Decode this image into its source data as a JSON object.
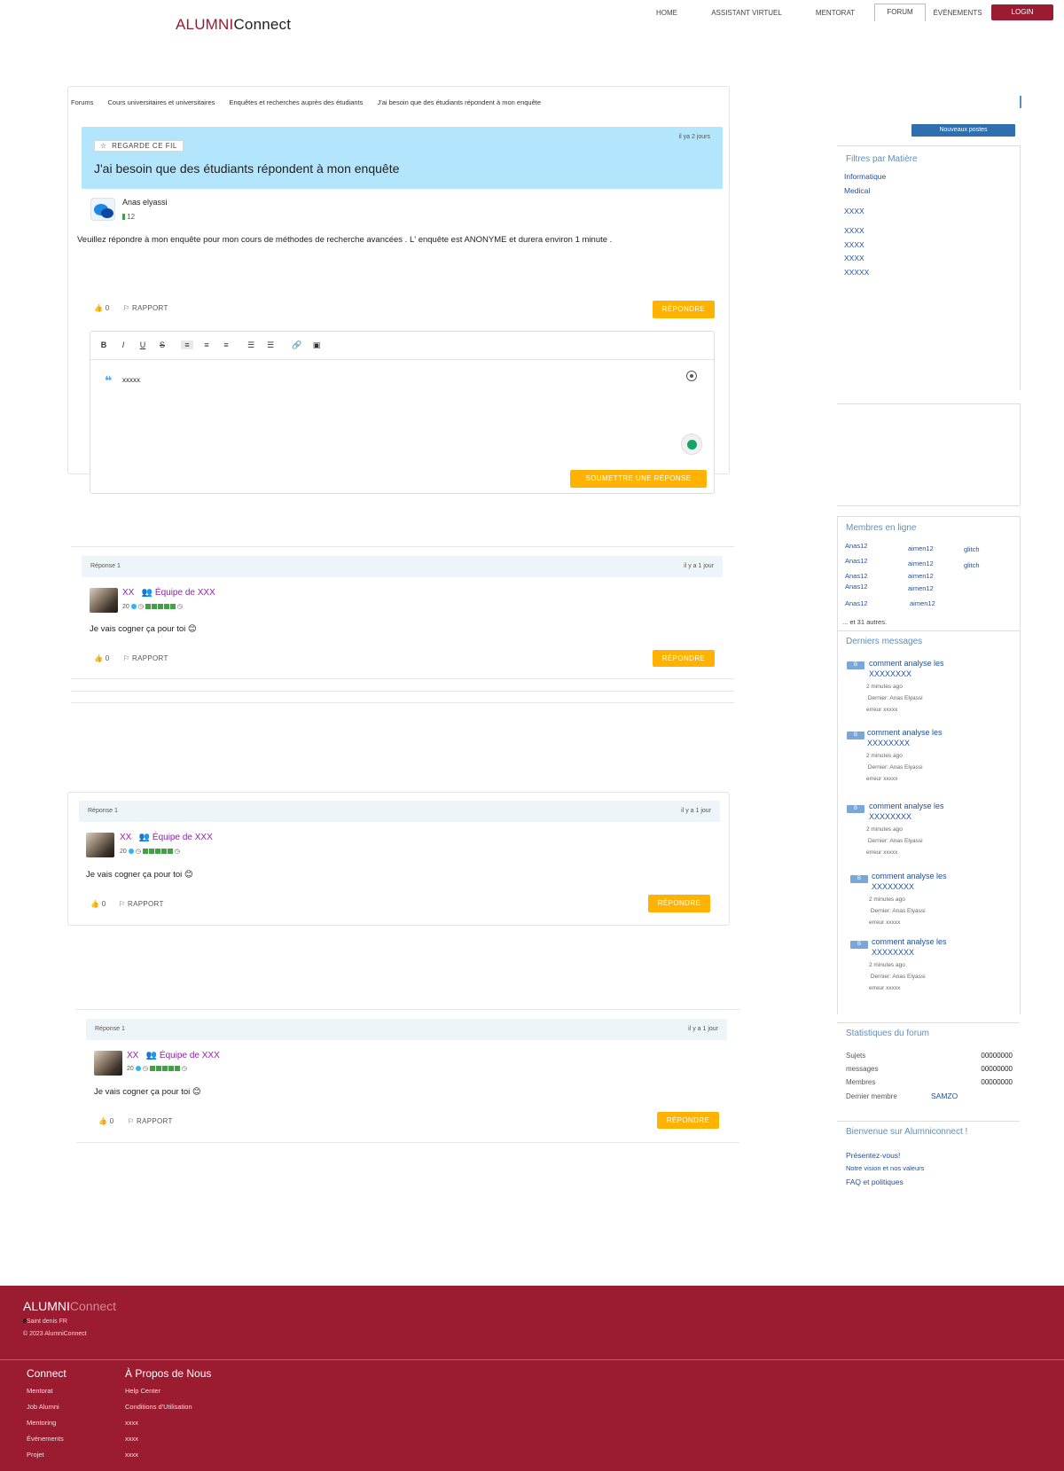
{
  "brand": {
    "part1": "ALUMNI",
    "part2": "Connect"
  },
  "nav": [
    {
      "label": "HOME"
    },
    {
      "label": "ASSISTANT VIRTUEL"
    },
    {
      "label": "MENTORAT"
    },
    {
      "label": "FORUM"
    },
    {
      "label": "ÉVÉNEMENTS"
    },
    {
      "label": "LOGIN"
    }
  ],
  "breadcrumb": [
    "Forums",
    "Cours universitaires et universitaires",
    "Enquêtes et recherches auprès des étudiants",
    "J'ai besoin que des étudiants répondent à mon enquête"
  ],
  "topic": {
    "watch_label": "REGARDE CE FIL",
    "watch_icon": "star-icon",
    "title": "J'ai besoin que des étudiants répondent à mon enquête",
    "time": "il ya 2 jours",
    "author": "Anas elyassi",
    "author_level": "12",
    "body": "Veuillez répondre à mon enquête pour mon cours de méthodes de recherche avancées . L' enquête est ANONYME  et durera environ 1 minute .",
    "likes": "0",
    "report_label": "RAPPORT",
    "reply_label": "RÉPONDRE"
  },
  "editor": {
    "toolbar": [
      "B",
      "I",
      "U",
      "S",
      "≡",
      "≡",
      "≡",
      "☰",
      "☰",
      "🔗",
      "▣"
    ],
    "content": "xxxxx",
    "submit_label": "SOUMETTRE UNE RÉPONSE"
  },
  "replies": [
    {
      "label": "Réponse 1",
      "time": "il y a 1 jour",
      "user": "XX",
      "team": "Équipe de XXX",
      "score": "20",
      "body": "Je vais cogner ça pour toi 😊",
      "likes": "0",
      "report_label": "RAPPORT",
      "reply_label": "RÉPONDRE"
    },
    {
      "label": "Réponse 1",
      "time": "il y a 1 jour",
      "user": "XX",
      "team": "Équipe de XXX",
      "score": "20",
      "body": "Je vais cogner ça pour toi 😊",
      "likes": "0",
      "report_label": "RAPPORT",
      "reply_label": "RÉPONDRE"
    },
    {
      "label": "Réponse 1",
      "time": "il y a 1 jour",
      "user": "XX",
      "team": "Équipe de XXX",
      "score": "20",
      "body": "Je vais cogner ça pour toi 😊",
      "likes": "0",
      "report_label": "RAPPORT",
      "reply_label": "RÉPONDRE"
    }
  ],
  "sidebar": {
    "new_post_label": "Nouveaux postes",
    "filters_title": "Filtres par Matière",
    "filters": [
      "Informatique",
      "Medical",
      "XXXX",
      "XXXX",
      "XXXX",
      "XXXX",
      "XXXXX"
    ],
    "online_title": "Membres en ligne",
    "online_members": [
      [
        "Anas12",
        "aimen12",
        "glitch"
      ],
      [
        "Anas12",
        "aimen12",
        "glitch"
      ],
      [
        "Anas12",
        "aimen12",
        ""
      ],
      [
        "Anas12",
        "aimen12",
        ""
      ],
      [
        "Anas12",
        "aimen12",
        ""
      ]
    ],
    "online_more": "... et 31 autres.",
    "recent_title": "Derniers messages",
    "recent": [
      {
        "badge": "B",
        "title1": "comment analyse les",
        "title2": "XXXXXXXX",
        "ago": "2 minutes ago",
        "last": "Dernier: Anas Elyassi",
        "tag": "erreur xxxxx"
      },
      {
        "badge": "B",
        "title1": "comment analyse les",
        "title2": "XXXXXXXX",
        "ago": "2 minutes ago",
        "last": "Dernier: Anas Elyassi",
        "tag": "erreur xxxxx"
      },
      {
        "badge": "B",
        "title1": "comment analyse les",
        "title2": "XXXXXXXX",
        "ago": "2 minutes ago",
        "last": "Dernier: Anas Elyassi",
        "tag": "erreur xxxxx"
      },
      {
        "badge": "B",
        "title1": "comment analyse les",
        "title2": "XXXXXXXX",
        "ago": "2 minutes ago",
        "last": "Dernier: Anas Elyassi",
        "tag": "erreur xxxxx"
      },
      {
        "badge": "B",
        "title1": "comment analyse les",
        "title2": "XXXXXXXX",
        "ago": "2 minutes ago",
        "last": "Dernier: Anas Elyassi",
        "tag": "erreur xxxxx"
      }
    ],
    "stats_title": "Statistiques du forum",
    "stats": [
      {
        "label": "Sujets",
        "value": "00000000"
      },
      {
        "label": "messages",
        "value": "00000000"
      },
      {
        "label": "Membres",
        "value": "00000000"
      }
    ],
    "last_member_label": "Dernier membre",
    "last_member": "SAMZO",
    "welcome_title": "Bienvenue sur Alumniconnect !",
    "welcome_links": [
      "Présentez-vous!",
      "Notre vision et nos valeurs",
      "FAQ et politiques"
    ]
  },
  "footer": {
    "location": "Saint denis FR",
    "copyright": "© 2023 AlumniConnect",
    "col1_title": "Connect",
    "col1": [
      "Mentorat",
      "Job  Alumni",
      "Mentoring",
      "Événements",
      "Projet"
    ],
    "col2_title": "À Propos de Nous",
    "col2": [
      "Help Center",
      "Conditions d'Utilisation",
      "xxxx",
      "xxxx",
      "xxxx"
    ]
  },
  "colors": {
    "brand": "#9b1b30",
    "accent": "#ffb300",
    "topic_bg": "#b3e5fc",
    "link": "#1f4e9e"
  }
}
